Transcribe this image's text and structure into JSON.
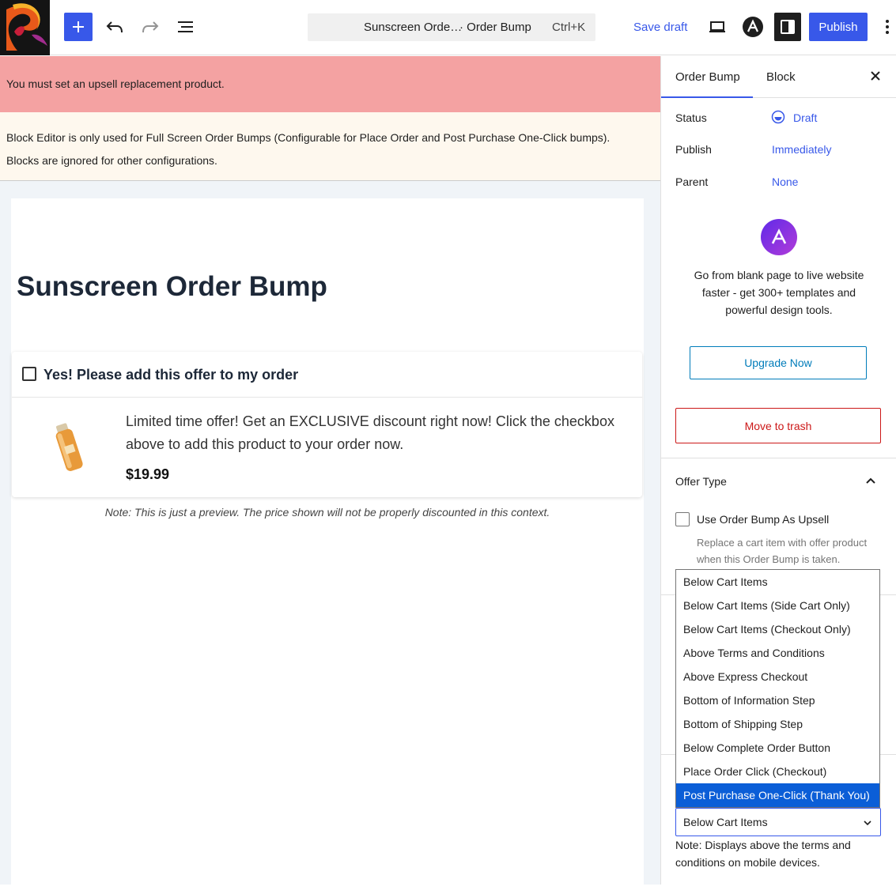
{
  "toolbar": {
    "save_draft": "Save draft",
    "publish": "Publish",
    "command": {
      "doc_title": "Sunscreen Orde…",
      "doc_type": "· Order Bump",
      "shortcut": "Ctrl+K"
    }
  },
  "notices": {
    "error": "You must set an upsell replacement product.",
    "info_line1": "Block Editor is only used for Full Screen Order Bumps (Configurable for Place Order and Post Purchase One-Click bumps).",
    "info_line2": "Blocks are ignored for other configurations."
  },
  "canvas": {
    "page_title": "Sunscreen Order Bump",
    "bump": {
      "checkbox_label": "Yes! Please add this offer to my order",
      "offer_text": "Limited time offer! Get an EXCLUSIVE discount right now! Click the checkbox above to add this product to your order now.",
      "price": "$19.99"
    },
    "preview_note": "Note: This is just a preview. The price shown will not be properly discounted in this context."
  },
  "sidebar": {
    "tabs": {
      "order_bump": "Order Bump",
      "block": "Block"
    },
    "status": {
      "label": "Status",
      "value": "Draft"
    },
    "publish": {
      "label": "Publish",
      "value": "Immediately"
    },
    "parent": {
      "label": "Parent",
      "value": "None"
    },
    "promo": {
      "text": "Go from blank page to live website faster - get 300+ templates and powerful design tools.",
      "button": "Upgrade Now"
    },
    "trash": "Move to trash",
    "offer_type": {
      "title": "Offer Type",
      "upsell_label": "Use Order Bump As Upsell",
      "upsell_help": "Replace a cart item with offer product when this Order Bump is taken."
    },
    "location": {
      "selected": "Below Cart Items",
      "options": [
        "Below Cart Items",
        "Below Cart Items (Side Cart Only)",
        "Below Cart Items (Checkout Only)",
        "Above Terms and Conditions",
        "Above Express Checkout",
        "Bottom of Information Step",
        "Bottom of Shipping Step",
        "Below Complete Order Button",
        "Place Order Click (Checkout)",
        "Post Purchase One-Click (Thank You)"
      ],
      "highlighted_option": "Post Purchase One-Click (Thank You)",
      "note": "Note: Displays above the terms and conditions on mobile devices."
    }
  },
  "colors": {
    "accent": "#3858e9",
    "error_bg": "#f4a2a2",
    "info_bg": "#fef8ee",
    "danger": "#cc1818",
    "select_highlight": "#0b5ed7"
  }
}
